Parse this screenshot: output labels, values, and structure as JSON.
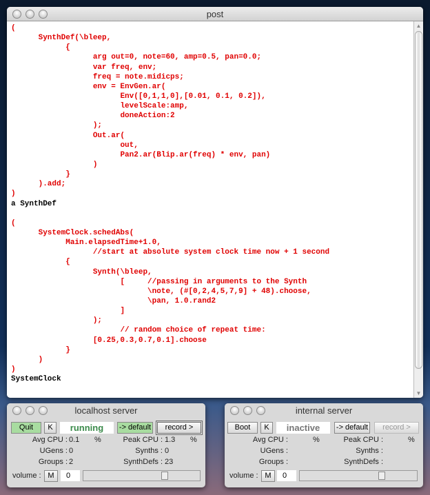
{
  "post": {
    "title": "post",
    "lines": [
      {
        "t": "(",
        "c": "#e00000"
      },
      {
        "t": "\tSynthDef(\\bleep,",
        "c": "#e00000"
      },
      {
        "t": "\t\t{",
        "c": "#e00000"
      },
      {
        "t": "\t\t\targ out=0, note=60, amp=0.5, pan=0.0;",
        "c": "#e00000"
      },
      {
        "t": "\t\t\tvar freq, env;",
        "c": "#e00000"
      },
      {
        "t": "\t\t\tfreq = note.midicps;",
        "c": "#e00000"
      },
      {
        "t": "\t\t\tenv = EnvGen.ar(",
        "c": "#e00000"
      },
      {
        "t": "\t\t\t\tEnv([0,1,1,0],[0.01, 0.1, 0.2]),",
        "c": "#e00000"
      },
      {
        "t": "\t\t\t\tlevelScale:amp,",
        "c": "#e00000"
      },
      {
        "t": "\t\t\t\tdoneAction:2",
        "c": "#e00000"
      },
      {
        "t": "\t\t\t);",
        "c": "#e00000"
      },
      {
        "t": "\t\t\tOut.ar(",
        "c": "#e00000"
      },
      {
        "t": "\t\t\t\tout,",
        "c": "#e00000"
      },
      {
        "t": "\t\t\t\tPan2.ar(Blip.ar(freq) * env, pan)",
        "c": "#e00000"
      },
      {
        "t": "\t\t\t)",
        "c": "#e00000"
      },
      {
        "t": "\t\t}",
        "c": "#e00000"
      },
      {
        "t": "\t).add;",
        "c": "#e00000"
      },
      {
        "t": ")",
        "c": "#e00000"
      },
      {
        "t": "a SynthDef",
        "c": "#000000"
      },
      {
        "t": "",
        "c": "#000000"
      },
      {
        "t": "(",
        "c": "#e00000"
      },
      {
        "t": "\tSystemClock.schedAbs(",
        "c": "#e00000"
      },
      {
        "t": "\t\tMain.elapsedTime+1.0,",
        "c": "#e00000"
      },
      {
        "t": "\t\t\t//start at absolute system clock time now + 1 second",
        "c": "#e00000"
      },
      {
        "t": "\t\t{",
        "c": "#e00000"
      },
      {
        "t": "\t\t\tSynth(\\bleep,",
        "c": "#e00000"
      },
      {
        "t": "\t\t\t\t[\t//passing in arguments to the Synth",
        "c": "#e00000"
      },
      {
        "t": "\t\t\t\t\t\\note, (#[0,2,4,5,7,9] + 48).choose,",
        "c": "#e00000"
      },
      {
        "t": "\t\t\t\t\t\\pan, 1.0.rand2",
        "c": "#e00000"
      },
      {
        "t": "\t\t\t\t]",
        "c": "#e00000"
      },
      {
        "t": "\t\t\t);",
        "c": "#e00000"
      },
      {
        "t": "\t\t\t\t// random choice of repeat time:",
        "c": "#e00000"
      },
      {
        "t": "\t\t\t[0.25,0.3,0.7,0.1].choose",
        "c": "#e00000"
      },
      {
        "t": "\t\t}",
        "c": "#e00000"
      },
      {
        "t": "\t)",
        "c": "#e00000"
      },
      {
        "t": ")",
        "c": "#e00000"
      },
      {
        "t": "SystemClock",
        "c": "#000000"
      }
    ]
  },
  "localhost": {
    "title": "localhost server",
    "boot_label": "Quit",
    "kill_label": "K",
    "status": "running",
    "default_label": "-> default",
    "record_label": "record >",
    "avg_cpu_label": "Avg CPU :",
    "avg_cpu": "0.1",
    "peak_cpu_label": "Peak CPU :",
    "peak_cpu": "1.3",
    "pct": "%",
    "ugens_label": "UGens :",
    "ugens": "0",
    "synths_label": "Synths :",
    "synths": "0",
    "groups_label": "Groups :",
    "groups": "2",
    "synthdefs_label": "SynthDefs :",
    "synthdefs": "23",
    "volume_label": "volume :",
    "mute_label": "M",
    "volume": "0",
    "volume_slider": 0.72
  },
  "internal": {
    "title": "internal server",
    "boot_label": "Boot",
    "kill_label": "K",
    "status": "inactive",
    "default_label": "-> default",
    "record_label": "record >",
    "avg_cpu_label": "Avg CPU :",
    "peak_cpu_label": "Peak CPU :",
    "pct": "%",
    "ugens_label": "UGens :",
    "synths_label": "Synths :",
    "groups_label": "Groups :",
    "synthdefs_label": "SynthDefs :",
    "volume_label": "volume :",
    "mute_label": "M",
    "volume": "0",
    "volume_slider": 0.72
  }
}
